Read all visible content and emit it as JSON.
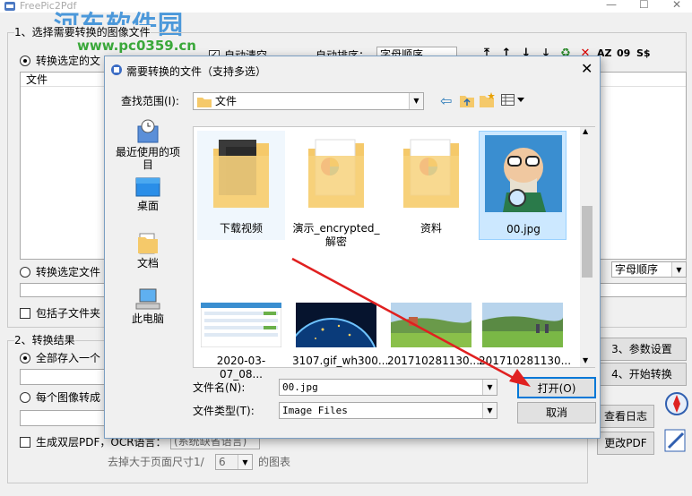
{
  "app": {
    "title": "FreePic2Pdf",
    "watermark": "河东软件园",
    "watermark_url": "www.pc0359.cn",
    "step1": "1、选择需要转换的图像文件",
    "radio_selected_files": "转换选定的文",
    "auto_clear": "自动清空",
    "auto_sort": "自动排序：",
    "sort_value": "字母顺序",
    "list_header": "文件",
    "radio_selected_folder": "转换选定文件",
    "sort_value_2": "字母顺序",
    "include_subfolders": "包括子文件夹",
    "step2": "2、转换结果",
    "radio_all_in_one": "全部存入一个",
    "radio_each_image": "每个图像转成",
    "dual_layer_pdf": "生成双层PDF，OCR语言：",
    "ocr_lang": "(系统缺省语言)",
    "remove_prefix": "去掉大于页面尺寸1/",
    "remove_value": "6",
    "remove_suffix": "的图表",
    "btn_params": "3、参数设置",
    "btn_start": "4、开始转换",
    "btn_log": "查看日志",
    "btn_modify_pdf": "更改PDF"
  },
  "dialog": {
    "title": "需要转换的文件（支持多选）",
    "look_in_label": "查找范围(I):",
    "look_in_value": "文件",
    "places": [
      {
        "label": "最近使用的项目",
        "icon": "recent-icon"
      },
      {
        "label": "桌面",
        "icon": "desktop-icon"
      },
      {
        "label": "文档",
        "icon": "documents-icon"
      },
      {
        "label": "此电脑",
        "icon": "computer-icon"
      }
    ],
    "items_row1": [
      {
        "name": "下载视频",
        "kind": "folder-dark"
      },
      {
        "name": "演示_encrypted_解密",
        "kind": "folder-chart"
      },
      {
        "name": "资料",
        "kind": "folder-chart"
      },
      {
        "name": "00.jpg",
        "kind": "image-cartoon",
        "selected": true
      }
    ],
    "items_row2": [
      {
        "name": "2020-03-07_08...",
        "kind": "screenshot"
      },
      {
        "name": "3107.gif_wh300...",
        "kind": "earth"
      },
      {
        "name": "201710281130...",
        "kind": "landscape"
      },
      {
        "name": "201710281130...",
        "kind": "landscape"
      }
    ],
    "filename_label": "文件名(N):",
    "filename_value": "00.jpg",
    "filetype_label": "文件类型(T):",
    "filetype_value": "Image Files",
    "open_button": "打开(O)",
    "cancel_button": "取消"
  },
  "colors": {
    "accent_red": "#e02020",
    "folder_yellow": "#f5c96a",
    "selection_blue": "#cce8ff"
  }
}
